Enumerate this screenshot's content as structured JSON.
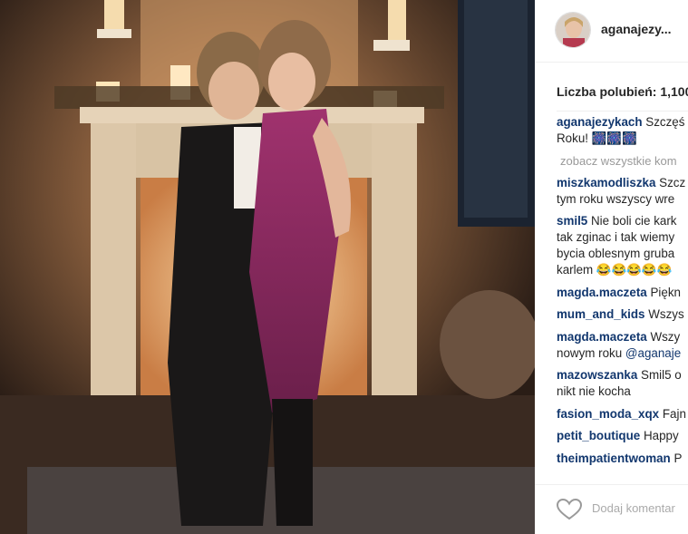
{
  "post": {
    "username": "aganajezy...",
    "likes_text": "Liczba polubień: 1,100"
  },
  "caption": {
    "user": "aganajezykach",
    "text_line1": "Szczęś",
    "text_line2": "Roku! 🎆🎆🎆"
  },
  "view_all_comments": "zobacz wszystkie kom",
  "comments": [
    {
      "user": "miszkamodliszka",
      "lines": [
        "Szcz",
        "tym roku wszyscy wre"
      ]
    },
    {
      "user": "smil5",
      "lines": [
        "Nie boli cie kark",
        "tak zginac i tak wiemy",
        "bycia oblesnym gruba",
        "karlem 😂😂😂😂😂"
      ]
    },
    {
      "user": "magda.maczeta",
      "lines": [
        "Piękn"
      ]
    },
    {
      "user": "mum_and_kids",
      "lines": [
        "Wszys"
      ]
    },
    {
      "user": "magda.maczeta",
      "lines": [
        "Wszy",
        "nowym roku "
      ],
      "mention": "@aganaje"
    },
    {
      "user": "mazowszanka",
      "lines": [
        "Smil5 o",
        "nikt nie kocha"
      ]
    },
    {
      "user": "fasion_moda_xqx",
      "lines": [
        "Fajn"
      ]
    },
    {
      "user": "petit_boutique",
      "lines": [
        "Happy"
      ]
    },
    {
      "user": "theimpatientwoman",
      "lines": [
        "P"
      ]
    }
  ],
  "add_comment_placeholder": "Dodaj komentar",
  "icons": {
    "like": "heart-outline-icon",
    "avatar": "profile-avatar"
  }
}
